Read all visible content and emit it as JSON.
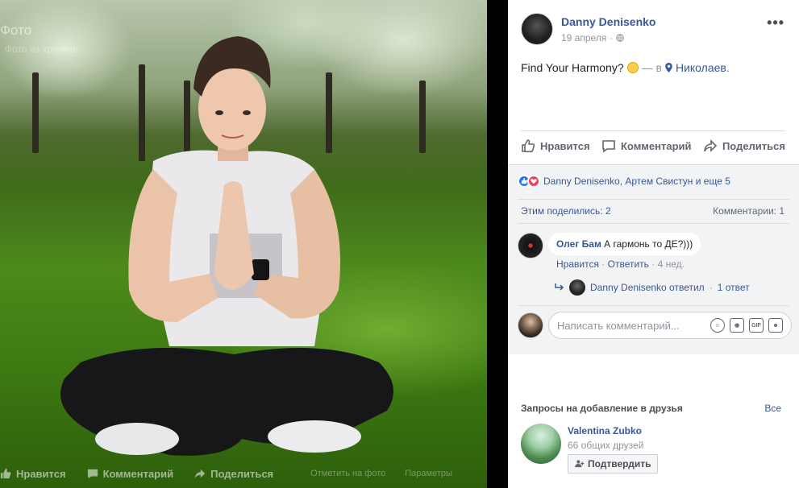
{
  "photo": {
    "title": "Фото",
    "subtitle": "Фото из хроники",
    "actions": {
      "like": "Нравится",
      "comment": "Комментарий",
      "share": "Поделиться",
      "tag": "Отметить на фото",
      "options": "Параметры"
    }
  },
  "post": {
    "author": "Danny Denisenko",
    "date": "19 апреля",
    "text": "Find Your Harmony?",
    "in_label": "— в",
    "place": "Николаев."
  },
  "actions": {
    "like": "Нравится",
    "comment": "Комментарий",
    "share": "Поделиться"
  },
  "reactions": {
    "text": "Danny Denisenko, Артем Свистун и еще 5"
  },
  "stats": {
    "shares": "Этим поделились: 2",
    "comments": "Комментарии: 1"
  },
  "comment": {
    "author": "Олег Бам",
    "text": "А гармонь то ДЕ?)))",
    "like": "Нравится",
    "reply": "Ответить",
    "age": "4 нед.",
    "sep": " · "
  },
  "reply_summary": {
    "text": "Danny Denisenko ответил",
    "count": "1 ответ",
    "sep": " · "
  },
  "write_comment": {
    "placeholder": "Написать комментарий..."
  },
  "friend_requests": {
    "title": "Запросы на добавление в друзья",
    "all": "Все",
    "name": "Valentina Zubko",
    "mutual": "66 общих друзей",
    "confirm": "Подтвердить"
  }
}
